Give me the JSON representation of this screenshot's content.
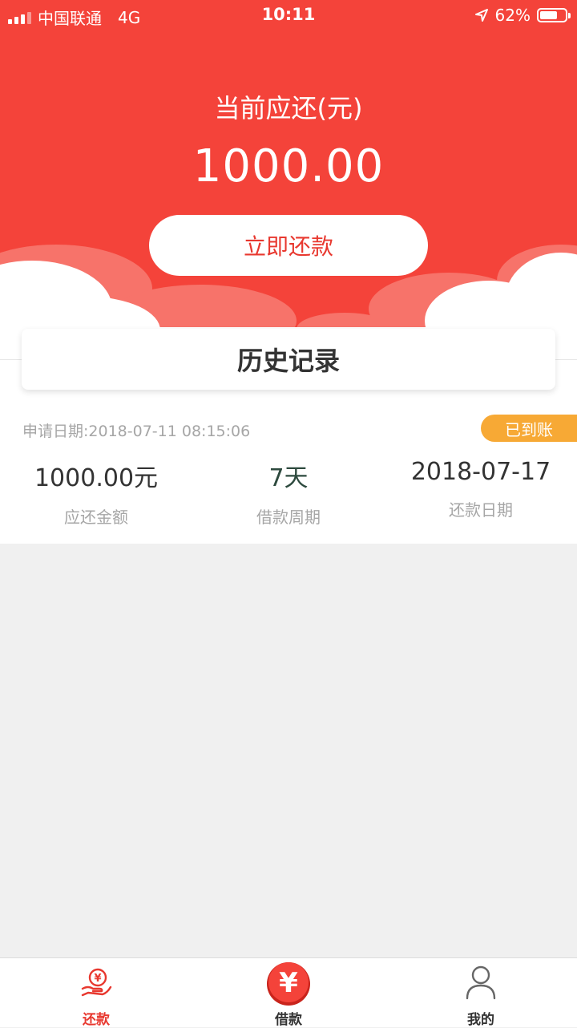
{
  "status_bar": {
    "carrier": "中国联通",
    "network": "4G",
    "time": "10:11",
    "battery": "62%"
  },
  "header": {
    "due_label": "当前应还(元)",
    "due_amount": "1000.00",
    "repay_button": "立即还款"
  },
  "history": {
    "title": "历史记录",
    "record": {
      "apply_date": "申请日期:2018-07-11 08:15:06",
      "status": "已到账",
      "columns": [
        {
          "value": "1000.00元",
          "label": "应还金额"
        },
        {
          "value": "7天",
          "label": "借款周期"
        },
        {
          "value": "2018-07-17",
          "label": "还款日期"
        }
      ]
    }
  },
  "tabbar": {
    "tabs": [
      {
        "label": "还款",
        "icon": "hand-yen-icon",
        "active": true
      },
      {
        "label": "借款",
        "icon": "yen-coin-icon",
        "active": false
      },
      {
        "label": "我的",
        "icon": "user-icon",
        "active": false
      }
    ]
  },
  "colors": {
    "brand_red": "#f4433a",
    "badge_orange": "#f7a935",
    "text_dark": "#333333",
    "text_gray": "#a6a6a6"
  }
}
